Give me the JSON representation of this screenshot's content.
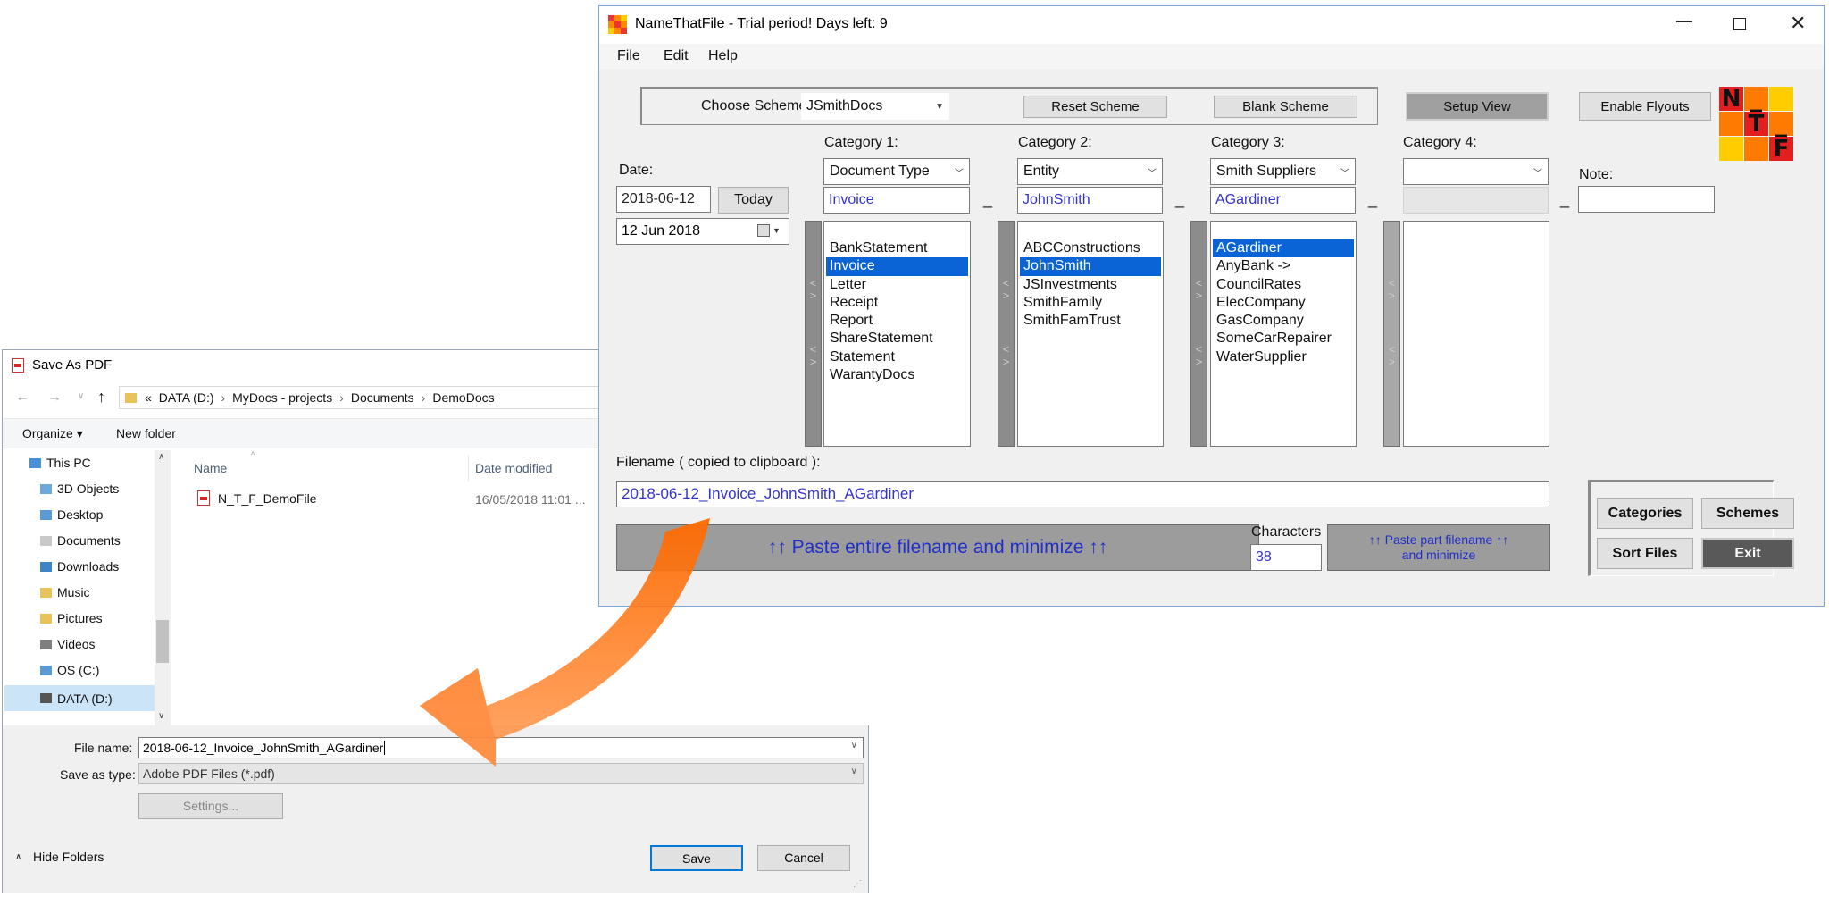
{
  "save_dialog": {
    "title": "Save As PDF",
    "path": [
      "«",
      "DATA (D:)",
      "MyDocs - projects",
      "Documents",
      "DemoDocs"
    ],
    "toolbar": {
      "organize": "Organize ▾",
      "new_folder": "New folder"
    },
    "tree": [
      "This PC",
      "3D Objects",
      "Desktop",
      "Documents",
      "Downloads",
      "Music",
      "Pictures",
      "Videos",
      "OS (C:)",
      "DATA (D:)"
    ],
    "columns": {
      "name": "Name",
      "date": "Date modified"
    },
    "files": [
      {
        "name": "N_T_F_DemoFile",
        "date": "16/05/2018 11:01 ..."
      }
    ],
    "file_name_label": "File name:",
    "file_name_value": "2018-06-12_Invoice_JohnSmith_AGardiner",
    "save_type_label": "Save as type:",
    "save_type_value": "Adobe PDF Files (*.pdf)",
    "settings": "Settings...",
    "save": "Save",
    "cancel": "Cancel",
    "hide_folders": "Hide Folders"
  },
  "ntf": {
    "title": "NameThatFile - Trial period! Days left: 9",
    "menu": [
      "File",
      "Edit",
      "Help"
    ],
    "choose_scheme_label": "Choose Scheme:",
    "scheme_value": "JSmithDocs",
    "reset_scheme": "Reset Scheme",
    "blank_scheme": "Blank Scheme",
    "setup_view": "Setup View",
    "enable_flyouts": "Enable Flyouts",
    "date_label": "Date:",
    "date_value": "2018-06-12",
    "today": "Today",
    "date_picker": "12  Jun  2018",
    "dash": "_",
    "categories": [
      {
        "label": "Category 1:",
        "combo": "Document Type",
        "value": "Invoice",
        "items": [
          "BankStatement",
          "Invoice",
          "Letter",
          "Receipt",
          "Report",
          "ShareStatement",
          "Statement",
          "WarantyDocs"
        ]
      },
      {
        "label": "Category 2:",
        "combo": "Entity",
        "value": "JohnSmith",
        "items": [
          "ABCConstructions",
          "JohnSmith",
          "JSInvestments",
          "SmithFamily",
          "SmithFamTrust"
        ]
      },
      {
        "label": "Category 3:",
        "combo": "Smith Suppliers",
        "value": "AGardiner",
        "items": [
          "AGardiner",
          "AnyBank ->",
          "CouncilRates",
          "ElecCompany",
          "GasCompany",
          "SomeCarRepairer",
          "WaterSupplier"
        ]
      },
      {
        "label": "Category 4:",
        "combo": "",
        "value": "",
        "items": []
      }
    ],
    "note_label": "Note:",
    "filename_label": "Filename ( copied to clipboard ):",
    "filename_value": "2018-06-12_Invoice_JohnSmith_AGardiner",
    "paste_entire": "↑↑  Paste entire filename and minimize  ↑↑",
    "characters_label": "Characters",
    "characters_value": "38",
    "paste_part": "↑↑  Paste part filename ↑↑\nand minimize",
    "btn_categories": "Categories",
    "btn_schemes": "Schemes",
    "btn_sort": "Sort Files",
    "btn_exit": "Exit",
    "logo_letters": [
      "N",
      "_",
      "T",
      "_",
      "F"
    ]
  }
}
